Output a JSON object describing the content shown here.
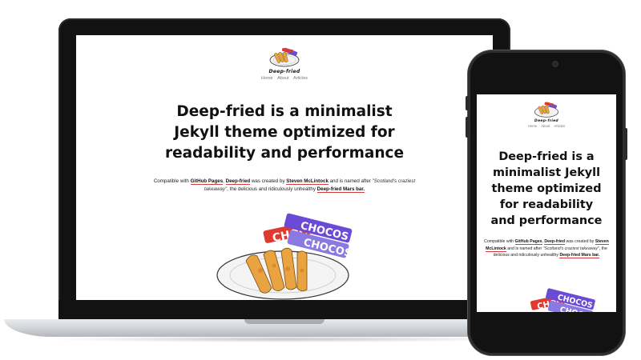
{
  "site": {
    "title": "Deep-fried",
    "nav": [
      "Home",
      "About",
      "Articles"
    ],
    "headline": "Deep-fried is a minimalist Jekyll theme optimized for readability and performance",
    "intro": {
      "p1": "Compatible with ",
      "link_github": "GitHub Pages",
      "p2": ", ",
      "link_deepfried": "Deep-fried",
      "p3": " was created by ",
      "link_author": "Steven McLintock",
      "p4": " and is named after ",
      "quote": "\"Scotland's craziest takeaway\"",
      "p5": ", the delicious and ridiculously unhealthy ",
      "link_mars": "Deep-fried Mars bar."
    },
    "hero_label": "CHOCOS"
  },
  "colors": {
    "device_frame": "#121212",
    "link_underline": "#d23b3b",
    "wrapper_purple": "#6b4bd6",
    "wrapper_red": "#e03a2f",
    "batter": "#e9a441"
  },
  "icons": {
    "logo": "fried-chocos-plate-logo",
    "hero": "fried-chocos-plate-illustration"
  }
}
